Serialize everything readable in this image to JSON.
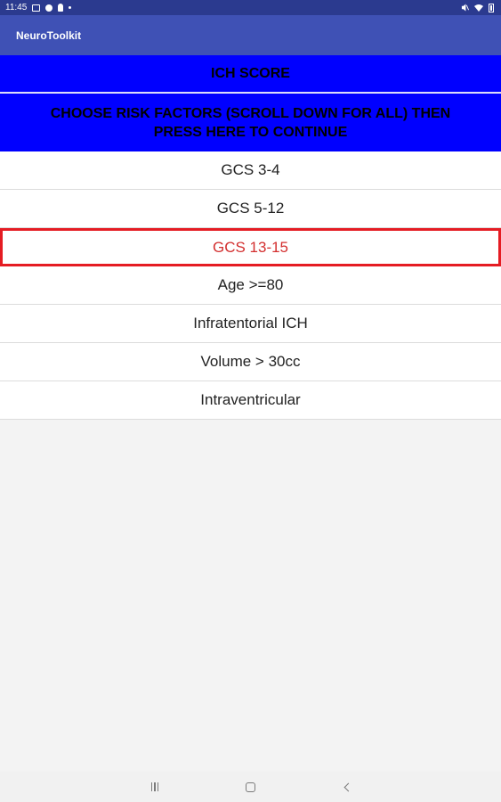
{
  "status_bar": {
    "time": "11:45",
    "icons_left": [
      "gallery-icon",
      "circle-icon",
      "person-icon",
      "dot-icon"
    ],
    "icons_right": [
      "mute-icon",
      "wifi-icon",
      "battery-icon"
    ]
  },
  "app_bar": {
    "title": "NeuroToolkit"
  },
  "header": {
    "title": "ICH SCORE",
    "continue_label": "CHOOSE RISK FACTORS (SCROLL DOWN FOR ALL) THEN PRESS HERE TO CONTINUE"
  },
  "options": [
    {
      "label": "GCS 3-4",
      "selected": false
    },
    {
      "label": "GCS 5-12",
      "selected": false
    },
    {
      "label": "GCS 13-15",
      "selected": true
    },
    {
      "label": "Age >=80",
      "selected": false
    },
    {
      "label": "Infratentorial ICH",
      "selected": false
    },
    {
      "label": "Volume > 30cc",
      "selected": false
    },
    {
      "label": "Intraventricular",
      "selected": false
    }
  ],
  "colors": {
    "status_bar": "#2b3a8f",
    "app_bar": "#3f51b5",
    "header": "#0000ff",
    "selected_border": "#e51c23",
    "selected_text": "#d32f2f"
  },
  "nav_bar": {
    "buttons": [
      "recents-icon",
      "home-icon",
      "back-icon"
    ]
  }
}
